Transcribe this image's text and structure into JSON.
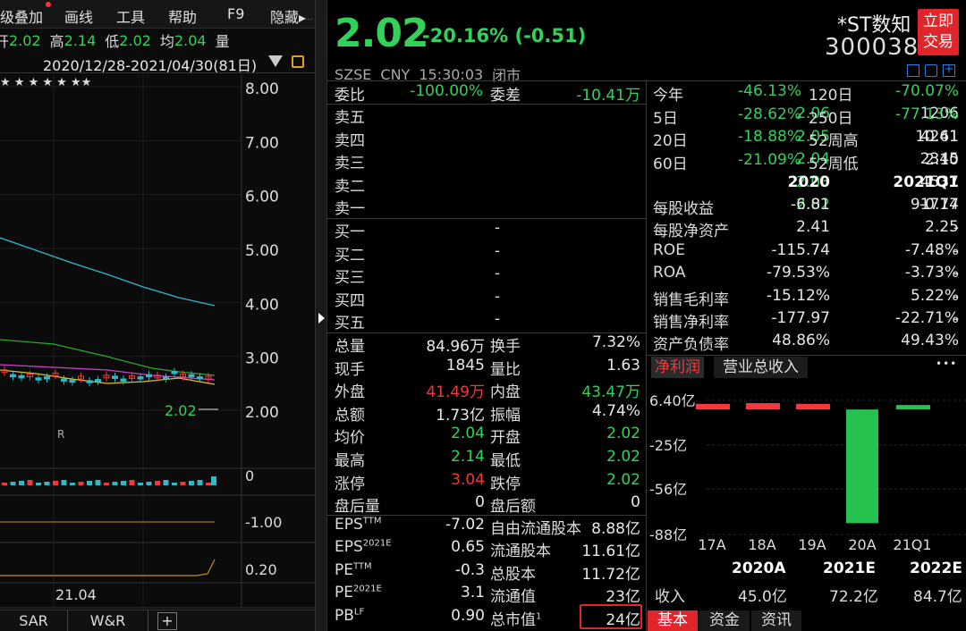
{
  "menu": {
    "items": [
      "级叠加",
      "画线",
      "工具",
      "帮助",
      "F9",
      "隐藏▸"
    ],
    "more": "..."
  },
  "quote_line": {
    "open_label": "开",
    "open": "2.02",
    "high_label": "高",
    "high": "2.14",
    "low_label": "低",
    "low": "2.02",
    "avg_label": "均",
    "avg": "2.04",
    "vol_label": "量"
  },
  "date_range": "2020/12/28-2021/04/30(81日)",
  "chart": {
    "y_ticks": [
      "8.00",
      "7.00",
      "6.00",
      "5.00",
      "4.00",
      "3.00",
      "2.00"
    ],
    "last_price_label": "2.02",
    "marker": "R",
    "stars": "★   ★  ★ ★   ★     ★★",
    "macd_ticks": [
      "0",
      "-1.00",
      "0.20"
    ],
    "x_label": "21.04",
    "tabs": [
      "SAR",
      "W&R",
      "+"
    ]
  },
  "header": {
    "price": "2.02",
    "change": "-20.16% (-0.51)",
    "name": "*ST数知",
    "code": "300038",
    "trade_button": [
      "立即",
      "交易"
    ],
    "exchange": "SZSE",
    "currency": "CNY",
    "time": "15:30:03",
    "status": "闭市"
  },
  "order_book": {
    "weibi_label": "委比",
    "weibi": "-100.00%",
    "weicha_label": "委差",
    "weicha": "-10.41万",
    "asks": [
      {
        "label": "卖五",
        "price": "2.06",
        "vol": "1206"
      },
      {
        "label": "卖四",
        "price": "2.05",
        "vol": "4261"
      },
      {
        "label": "卖三",
        "price": "2.04",
        "vol": "2345"
      },
      {
        "label": "卖二",
        "price": "2.03",
        "vol": "4537"
      },
      {
        "label": "卖一",
        "price": "2.02",
        "vol": "91774"
      }
    ],
    "bids": [
      {
        "label": "买一",
        "price": "-",
        "vol": "-"
      },
      {
        "label": "买二",
        "price": "-",
        "vol": "-"
      },
      {
        "label": "买三",
        "price": "-",
        "vol": "-"
      },
      {
        "label": "买四",
        "price": "-",
        "vol": "-"
      },
      {
        "label": "买五",
        "price": "-",
        "vol": "-"
      }
    ]
  },
  "stats": [
    {
      "l1": "总量",
      "v1": "84.96万",
      "c1": "w",
      "l2": "换手",
      "v2": "7.32%",
      "c2": "w"
    },
    {
      "l1": "现手",
      "v1": "1845",
      "c1": "w",
      "l2": "量比",
      "v2": "1.63",
      "c2": "w"
    },
    {
      "l1": "外盘",
      "v1": "41.49万",
      "c1": "r",
      "l2": "内盘",
      "v2": "43.47万",
      "c2": "g"
    },
    {
      "l1": "总额",
      "v1": "1.73亿",
      "c1": "w",
      "l2": "振幅",
      "v2": "4.74%",
      "c2": "w"
    },
    {
      "l1": "均价",
      "v1": "2.04",
      "c1": "g",
      "l2": "开盘",
      "v2": "2.02",
      "c2": "g"
    },
    {
      "l1": "最高",
      "v1": "2.14",
      "c1": "g",
      "l2": "最低",
      "v2": "2.02",
      "c2": "g"
    },
    {
      "l1": "涨停",
      "v1": "3.04",
      "c1": "r",
      "l2": "跌停",
      "v2": "2.02",
      "c2": "g"
    },
    {
      "l1": "盘后量",
      "v1": "0",
      "c1": "w",
      "l2": "盘后额",
      "v2": "0",
      "c2": "w"
    }
  ],
  "valuation": [
    {
      "l1": "EPS",
      "s1": "TTM",
      "v1": "-7.02",
      "l2": "自由流通股本",
      "s2": "",
      "v2": "8.88亿"
    },
    {
      "l1": "EPS",
      "s1": "2021E",
      "v1": "0.65",
      "l2": "流通股本",
      "s2": "",
      "v2": "11.61亿"
    },
    {
      "l1": "PE",
      "s1": "TTM",
      "v1": "-0.3",
      "l2": "总股本",
      "s2": "",
      "v2": "11.72亿"
    },
    {
      "l1": "PE",
      "s1": "2021E",
      "v1": "3.1",
      "l2": "流通值",
      "s2": "",
      "v2": "23亿"
    },
    {
      "l1": "PB",
      "s1": "LF",
      "v1": "0.90",
      "l2": "总市值",
      "s2": "1",
      "v2": "24亿"
    }
  ],
  "perf": [
    {
      "l1": "今年",
      "v1": "-46.13%",
      "c1": "g",
      "l2": "120日",
      "v2": "-70.07%",
      "c2": "g"
    },
    {
      "l1": "5日",
      "v1": "-28.62%",
      "c1": "g",
      "l2": "250日",
      "v2": "-77.13%",
      "c2": "g"
    },
    {
      "l1": "20日",
      "v1": "-18.88%",
      "c1": "g",
      "l2": "52周高",
      "v2": "10.41",
      "c2": "w"
    },
    {
      "l1": "60日",
      "v1": "-21.09%",
      "c1": "g",
      "l2": "52周低",
      "v2": "2.10",
      "c2": "w"
    }
  ],
  "fin": {
    "years": [
      "2020",
      "2021Q1"
    ],
    "rows": [
      {
        "label": "每股收益",
        "a": "-6.81",
        "b": "-0.17"
      },
      {
        "label": "每股净资产",
        "a": "2.41",
        "b": "2.25"
      },
      {
        "label": "ROE",
        "a": "-115.74",
        "b": "-7.48%"
      },
      {
        "label": "ROA",
        "a": "-79.53%",
        "b": "-3.73%"
      },
      {
        "label": "销售毛利率",
        "a": "-15.12%",
        "b": "5.22%"
      },
      {
        "label": "销售净利率",
        "a": "-177.97",
        "b": "-22.71%"
      },
      {
        "label": "资产负债率",
        "a": "48.86%",
        "b": "49.43%"
      }
    ]
  },
  "profit_tabs": [
    "净利润",
    "营业总收入"
  ],
  "profit_more": "•••",
  "chart_data": {
    "type": "bar",
    "categories": [
      "17A",
      "18A",
      "19A",
      "20A",
      "21Q1"
    ],
    "values": [
      4.0,
      4.5,
      4.0,
      -80.0,
      2.0
    ],
    "unit": "亿",
    "y_ticks": [
      "6.40亿",
      "-25亿",
      "-56亿",
      "-88亿"
    ],
    "ylim": [
      -88,
      6.4
    ],
    "colors": {
      "positive": "#f0393a",
      "negative": "#26c24f"
    }
  },
  "forecast": {
    "years": [
      "2020A",
      "2021E",
      "2022E"
    ],
    "label": "收入",
    "values": [
      "45.0亿",
      "72.2亿",
      "84.7亿"
    ]
  },
  "bottom_tabs": [
    "基本",
    "资金",
    "资讯"
  ]
}
